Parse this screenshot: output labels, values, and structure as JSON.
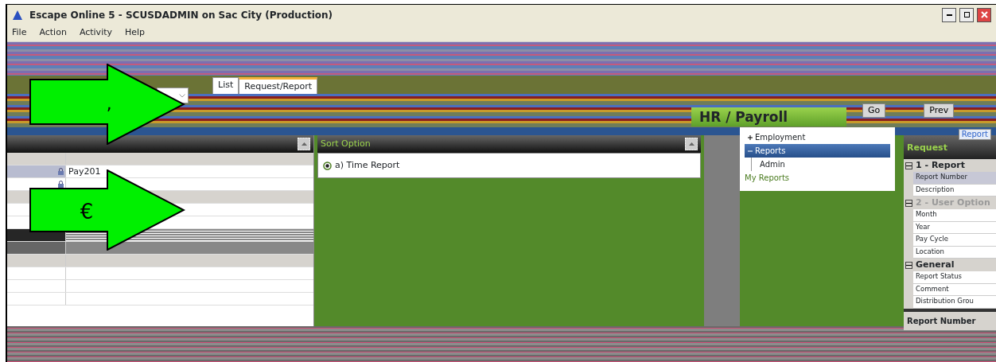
{
  "window": {
    "title": "Escape Online 5 - SCUSDADMIN on Sac City (Production)"
  },
  "menu": [
    "File",
    "Action",
    "Activity",
    "Help"
  ],
  "tabs": [
    {
      "label": "List",
      "selected": false
    },
    {
      "label": "Request/Report",
      "selected": true
    }
  ],
  "module_header": {
    "title": "HR / Payroll"
  },
  "toolbar_buttons": [
    "Go",
    "Prev"
  ],
  "arrows": [
    {
      "label": "‚"
    },
    {
      "label": "€"
    }
  ],
  "detail_panel": {
    "rows": [
      {
        "kind": "section"
      },
      {
        "kind": "locked",
        "value": "Pay201"
      },
      {
        "kind": "locked",
        "value": ""
      },
      {
        "kind": "section"
      },
      {
        "kind": "plain"
      },
      {
        "kind": "plain"
      },
      {
        "kind": "dark"
      },
      {
        "kind": "grey"
      },
      {
        "kind": "section"
      },
      {
        "kind": "plain"
      },
      {
        "kind": "plain"
      },
      {
        "kind": "plain"
      }
    ]
  },
  "sort_option": {
    "title": "Sort Option",
    "options": [
      {
        "label": "a) Time Report",
        "selected": true
      }
    ]
  },
  "tree": [
    {
      "label": "Employment",
      "expanded": false,
      "selected": false
    },
    {
      "label": "Reports",
      "expanded": true,
      "selected": true,
      "children": [
        {
          "label": "Admin",
          "selected": false
        }
      ]
    },
    {
      "label": "My Reports",
      "kind": "link"
    }
  ],
  "report_button": "Report",
  "request": {
    "title": "Request",
    "groups": [
      {
        "name": "1 - Report",
        "expanded": true,
        "dimmed": false,
        "items": [
          {
            "label": "Report Number",
            "selected": true
          },
          {
            "label": "Description",
            "selected": false
          }
        ]
      },
      {
        "name": "2 - User Option",
        "expanded": true,
        "dimmed": true,
        "items": [
          {
            "label": "Month",
            "selected": false
          },
          {
            "label": "Year",
            "selected": false
          },
          {
            "label": "Pay Cycle",
            "selected": false
          },
          {
            "label": "Location",
            "selected": false
          }
        ]
      },
      {
        "name": "General",
        "expanded": true,
        "dimmed": false,
        "items": [
          {
            "label": "Report Status",
            "selected": false
          },
          {
            "label": "Comment",
            "selected": false
          },
          {
            "label": "Distribution Grou",
            "selected": false
          }
        ]
      }
    ],
    "help_title": "Report Number"
  }
}
